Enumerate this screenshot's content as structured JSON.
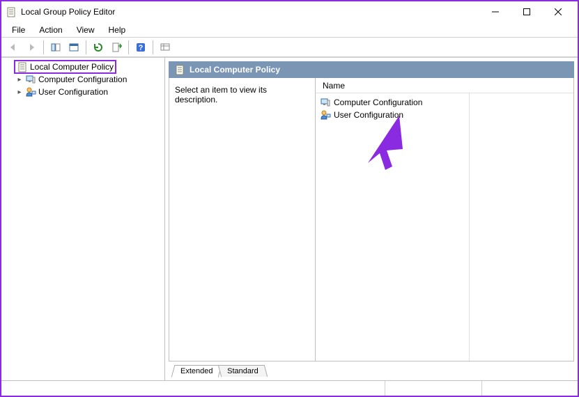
{
  "window": {
    "title": "Local Group Policy Editor"
  },
  "menubar": [
    "File",
    "Action",
    "View",
    "Help"
  ],
  "tree": {
    "root": "Local Computer Policy",
    "children": [
      "Computer Configuration",
      "User Configuration"
    ]
  },
  "main": {
    "header": "Local Computer Policy",
    "desc": "Select an item to view its description.",
    "col_header": "Name",
    "items": [
      "Computer Configuration",
      "User Configuration"
    ]
  },
  "tabs": [
    "Extended",
    "Standard"
  ],
  "colors": {
    "annotation": "#8a2be2"
  }
}
